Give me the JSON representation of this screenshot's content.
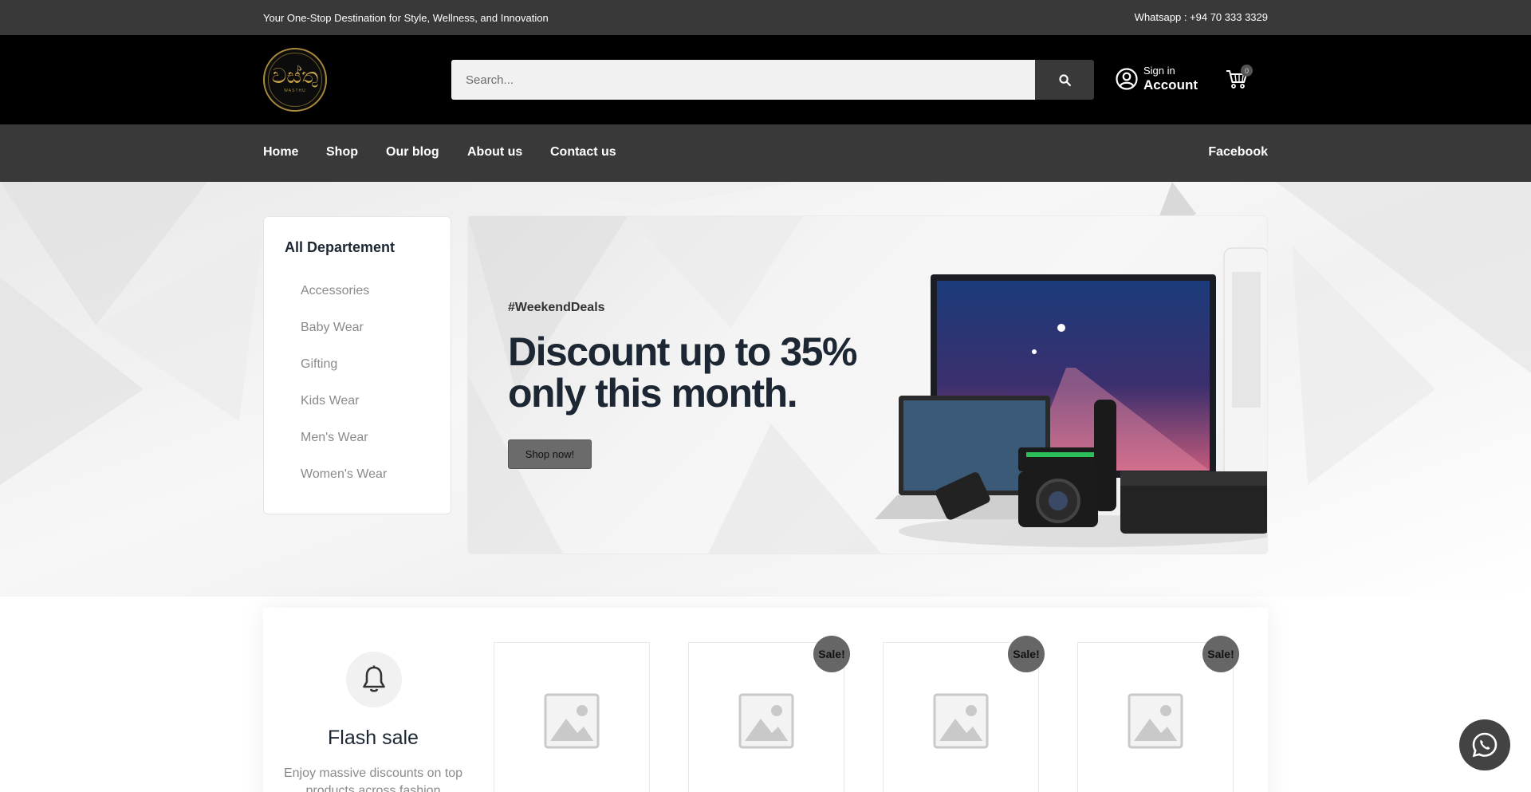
{
  "topbar": {
    "tagline": "Your One-Stop Destination for Style, Wellness, and Innovation",
    "whatsapp": "Whatsapp : +94 70 333 3329"
  },
  "header": {
    "logo_text": "වස්තු",
    "logo_sub": "WASTHU",
    "search_placeholder": "Search...",
    "account_small": "Sign in",
    "account_big": "Account",
    "cart_count": "0"
  },
  "nav": {
    "items": [
      "Home",
      "Shop",
      "Our blog",
      "About us",
      "Contact us"
    ],
    "social": "Facebook"
  },
  "departments": {
    "title": "All Departement",
    "items": [
      "Accessories",
      "Baby Wear",
      "Gifting",
      "Kids Wear",
      "Men's Wear",
      "Women's Wear"
    ]
  },
  "banner": {
    "tag": "#WeekendDeals",
    "headline_1": "Discount up to 35%",
    "headline_2": "only this month.",
    "button": "Shop now!"
  },
  "flash": {
    "title": "Flash sale",
    "description": "Enjoy massive discounts on top products across fashion"
  },
  "products": {
    "sale_label": "Sale!",
    "items": [
      {
        "on_sale": false
      },
      {
        "on_sale": true
      },
      {
        "on_sale": true
      },
      {
        "on_sale": true
      }
    ]
  },
  "colors": {
    "topbar": "#393939",
    "header": "#000000",
    "nav": "#393939",
    "accent_gold": "#c9a54c",
    "button_grey": "#6b6b6b"
  },
  "icons": {
    "search": "search-icon",
    "account": "user-circle-icon",
    "cart": "cart-icon",
    "flash": "bell-icon",
    "whatsapp": "whatsapp-icon",
    "placeholder": "image-placeholder-icon"
  }
}
